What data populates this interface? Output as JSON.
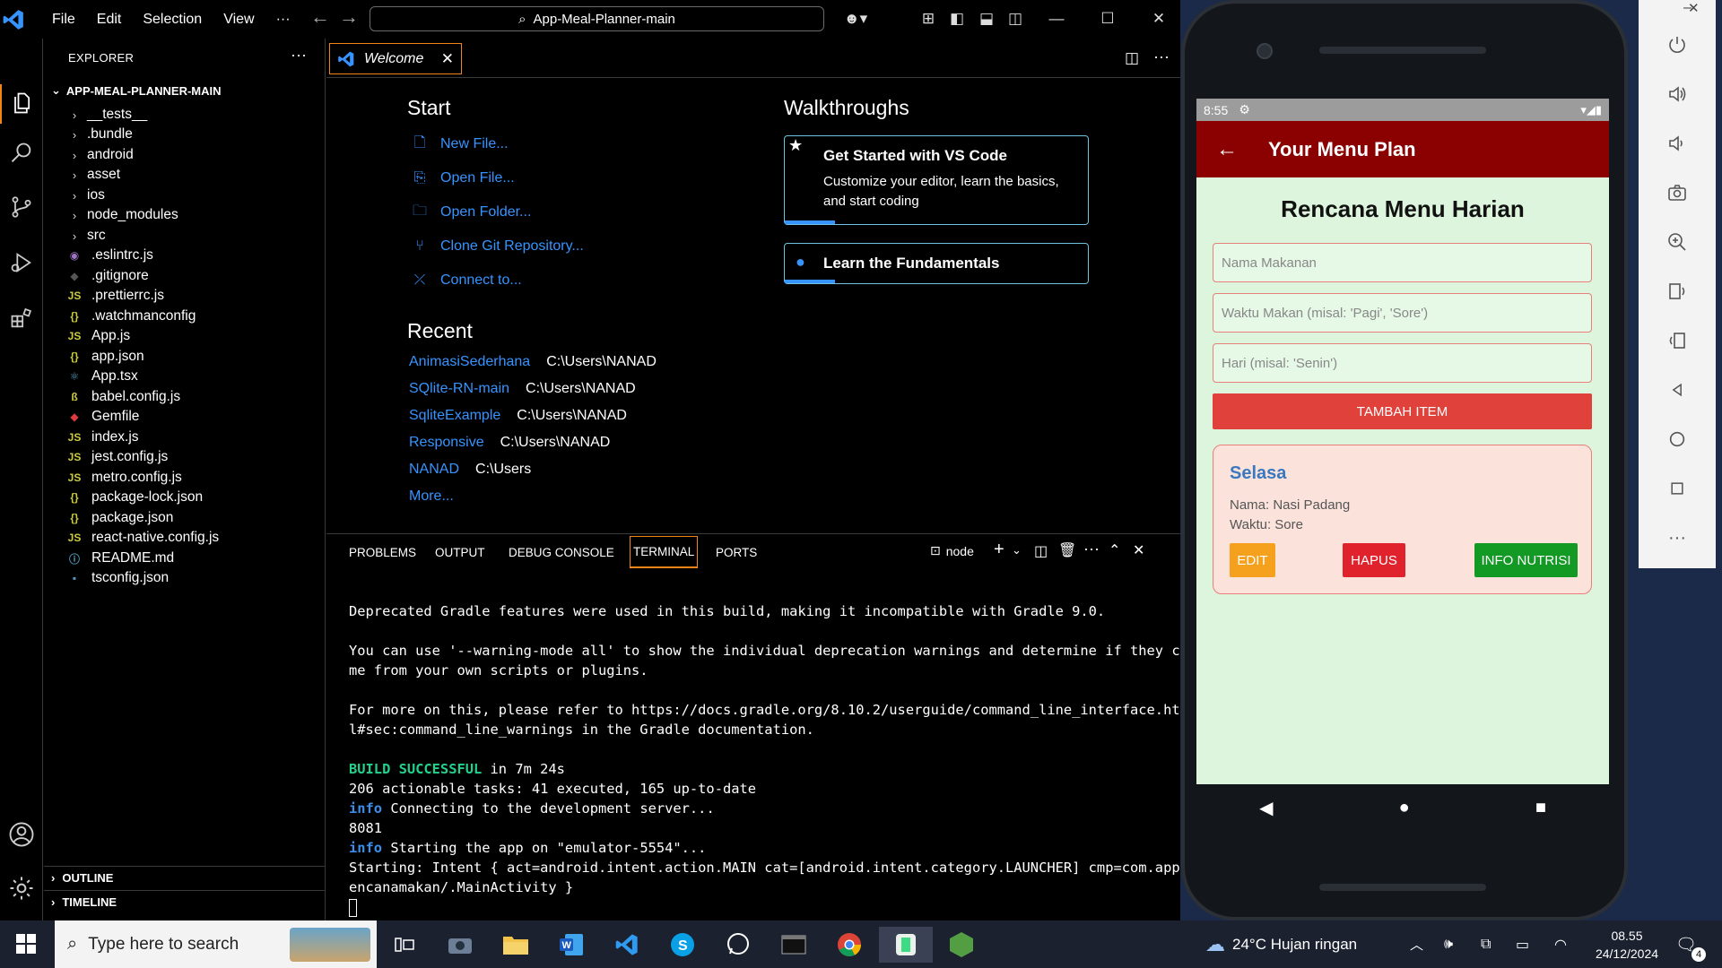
{
  "vscode": {
    "menu": [
      "File",
      "Edit",
      "Selection",
      "View",
      "···"
    ],
    "search_title": "App-Meal-Planner-main",
    "explorer_title": "EXPLORER",
    "project_root": "APP-MEAL-PLANNER-MAIN",
    "folders": [
      "__tests__",
      ".bundle",
      "android",
      "asset",
      "ios",
      "node_modules",
      "src"
    ],
    "files": [
      {
        "name": ".eslintrc.js",
        "icon": "eslint-icon"
      },
      {
        "name": ".gitignore",
        "icon": "git-icon"
      },
      {
        "name": ".prettierrc.js",
        "icon": "js-icon"
      },
      {
        "name": ".watchmanconfig",
        "icon": "json-icon"
      },
      {
        "name": "App.js",
        "icon": "js-icon"
      },
      {
        "name": "app.json",
        "icon": "json-icon"
      },
      {
        "name": "App.tsx",
        "icon": "react-icon"
      },
      {
        "name": "babel.config.js",
        "icon": "babel-icon"
      },
      {
        "name": "Gemfile",
        "icon": "ruby-icon"
      },
      {
        "name": "index.js",
        "icon": "js-icon"
      },
      {
        "name": "jest.config.js",
        "icon": "js-icon"
      },
      {
        "name": "metro.config.js",
        "icon": "js-icon"
      },
      {
        "name": "package-lock.json",
        "icon": "json-icon"
      },
      {
        "name": "package.json",
        "icon": "json-icon"
      },
      {
        "name": "react-native.config.js",
        "icon": "js-icon"
      },
      {
        "name": "README.md",
        "icon": "info-icon"
      },
      {
        "name": "tsconfig.json",
        "icon": "ts-icon"
      }
    ],
    "outline": "OUTLINE",
    "timeline": "TIMELINE",
    "welcome_tab": "Welcome",
    "start_heading": "Start",
    "start_items": [
      "New File...",
      "Open File...",
      "Open Folder...",
      "Clone Git Repository...",
      "Connect to..."
    ],
    "recent_heading": "Recent",
    "recent": [
      {
        "name": "AnimasiSederhana",
        "path": "C:\\Users\\NANAD"
      },
      {
        "name": "SQlite-RN-main",
        "path": "C:\\Users\\NANAD"
      },
      {
        "name": "SqliteExample",
        "path": "C:\\Users\\NANAD"
      },
      {
        "name": "Responsive",
        "path": "C:\\Users\\NANAD"
      },
      {
        "name": "NANAD",
        "path": "C:\\Users"
      }
    ],
    "more": "More...",
    "walkthroughs_heading": "Walkthroughs",
    "walk1_title": "Get Started with VS Code",
    "walk1_desc": "Customize your editor, learn the basics, and start coding",
    "walk2_title": "Learn the Fundamentals",
    "panel_tabs": [
      "PROBLEMS",
      "OUTPUT",
      "DEBUG CONSOLE",
      "TERMINAL",
      "PORTS"
    ],
    "terminal_name": "node",
    "terminal": {
      "l1": "Deprecated Gradle features were used in this build, making it incompatible with Gradle 9.0.",
      "l2": "You can use '--warning-mode all' to show the individual deprecation warnings and determine if they co",
      "l3": "me from your own scripts or plugins.",
      "l4": "For more on this, please refer to https://docs.gradle.org/8.10.2/userguide/command_line_interface.htm",
      "l5": "l#sec:command_line_warnings in the Gradle documentation.",
      "build_tag": "BUILD SUCCESSFUL",
      "build_rest": " in 7m 24s",
      "l7": "206 actionable tasks: 41 executed, 165 up-to-date",
      "info": "info",
      "l8": " Connecting to the development server...",
      "l9": "8081",
      "l10": " Starting the app on \"emulator-5554\"...",
      "l11": "Starting: Intent { act=android.intent.action.MAIN cat=[android.intent.category.LAUNCHER] cmp=com.appr",
      "l12": "encanamakan/.MainActivity }"
    }
  },
  "phone": {
    "time": "8:55",
    "app_title": "Your Menu Plan",
    "heading": "Rencana Menu Harian",
    "placeholders": [
      "Nama Makanan",
      "Waktu Makan (misal: 'Pagi', 'Sore')",
      "Hari (misal: 'Senin')"
    ],
    "add_button": "TAMBAH ITEM",
    "card": {
      "day": "Selasa",
      "name": "Nama: Nasi Padang",
      "time": "Waktu: Sore",
      "edit": "EDIT",
      "delete": "HAPUS",
      "info": "INFO NUTRISI"
    }
  },
  "taskbar": {
    "search_placeholder": "Type here to search",
    "weather": "24°C  Hujan ringan",
    "clock_time": "08.55",
    "clock_date": "24/12/2024",
    "notification_count": "4"
  },
  "colors": {
    "accent": "#f38518",
    "link": "#3794ff",
    "appbar": "#8b0000",
    "add_button": "#e0413a"
  }
}
